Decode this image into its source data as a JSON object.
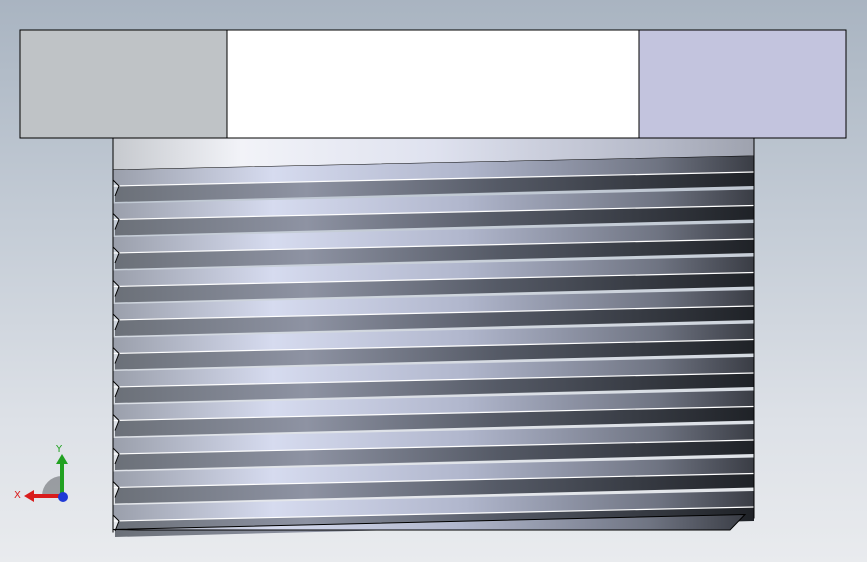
{
  "viewport": {
    "background_top": "#a9b4c1",
    "background_bottom": "#e9ebee"
  },
  "model": {
    "part": "threaded-hex-plug",
    "view": "front",
    "thread_count": 11,
    "colors": {
      "hex_face_left": "#bfc3c6",
      "hex_face_center": "#ffffff",
      "hex_face_right": "#c3c4de",
      "outline": "#000000",
      "thread_light": "#d8dcf0",
      "thread_dark": "#2a2d33"
    }
  },
  "triad": {
    "x_label": "X",
    "y_label": "Y",
    "x_color": "#d91c1c",
    "y_color": "#21a121",
    "z_color": "#1f3ad6"
  }
}
